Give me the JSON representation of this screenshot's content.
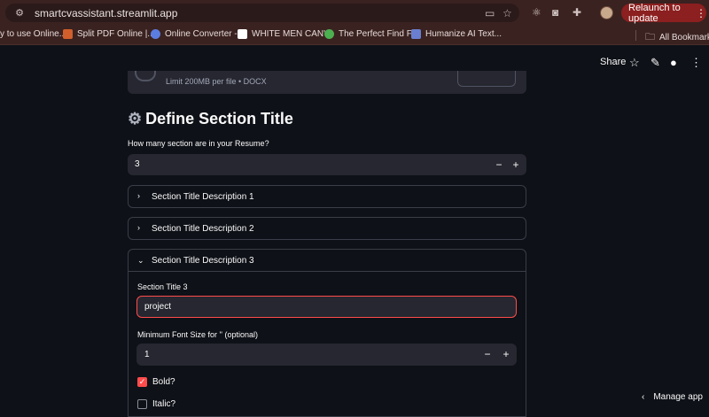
{
  "browser": {
    "url": "smartcvassistant.streamlit.app",
    "relaunch_label": "Relaunch to update",
    "relaunch_menu": "⋮"
  },
  "bookmarks": [
    {
      "label": "y to use Online...",
      "color": "#d64d3a"
    },
    {
      "label": "Split PDF Online |...",
      "color": "#d05f2c"
    },
    {
      "label": "Online Converter -...",
      "color": "#5b7ce0"
    },
    {
      "label": "WHITE MEN CAN'...",
      "color": "#2a2a2a"
    },
    {
      "label": "The Perfect Find F...",
      "color": "#4caf50"
    },
    {
      "label": "Humanize AI Text...",
      "color": "#6a7fd1"
    },
    {
      "label": "All Bookmarks",
      "color": "#000000"
    }
  ],
  "header": {
    "share_label": "Share"
  },
  "uploader": {
    "limit_text": "Limit 200MB per file • DOCX"
  },
  "section": {
    "title": "Define Section Title",
    "question": "How many section are in your Resume?",
    "count_value": "3",
    "minus": "−",
    "plus": "+"
  },
  "expanders": [
    {
      "title": "Section Title Description 1",
      "chevron": "›"
    },
    {
      "title": "Section Title Description 2",
      "chevron": "›"
    },
    {
      "title": "Section Title Description 3",
      "chevron": "⌄"
    }
  ],
  "open_expander": {
    "section_label": "Section Title 3",
    "section_value": "project",
    "font_size_label": "Minimum Font Size for '' (optional)",
    "font_size_value": "1",
    "minus": "−",
    "plus": "+",
    "bold_label": "Bold?",
    "bold_checked": true,
    "italic_label": "Italic?",
    "italic_checked": false
  },
  "footer": {
    "manage_label": "Manage app"
  }
}
